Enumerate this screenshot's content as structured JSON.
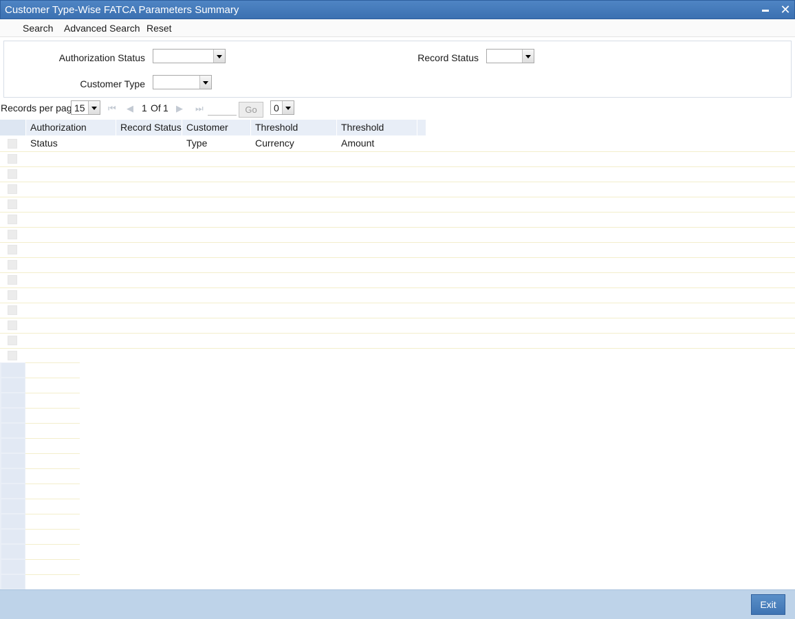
{
  "window": {
    "title": "Customer Type-Wise FATCA Parameters Summary",
    "minimize_icon": "minimize-icon",
    "close_icon": "close-icon"
  },
  "menu": {
    "search": "Search",
    "advanced_search": "Advanced Search",
    "reset": "Reset"
  },
  "criteria": {
    "authorization_status": {
      "label": "Authorization Status",
      "value": ""
    },
    "record_status": {
      "label": "Record Status",
      "value": ""
    },
    "customer_type": {
      "label": "Customer Type",
      "value": ""
    }
  },
  "pager": {
    "records_per_page_label": "Records per page",
    "records_per_page": "15",
    "current_page": "1",
    "of_label": "Of",
    "total_pages": "1",
    "goto_value": "",
    "go_label": "Go",
    "page_select": "0"
  },
  "grid": {
    "columns": [
      "Authorization Status",
      "Record Status",
      "Customer Type",
      "Threshold Currency",
      "Threshold Amount"
    ],
    "rows": []
  },
  "footer": {
    "exit": "Exit"
  },
  "colors": {
    "titlebar": "#3b70b1",
    "footer": "#bed3e9",
    "header_bg": "#e8eef7"
  }
}
